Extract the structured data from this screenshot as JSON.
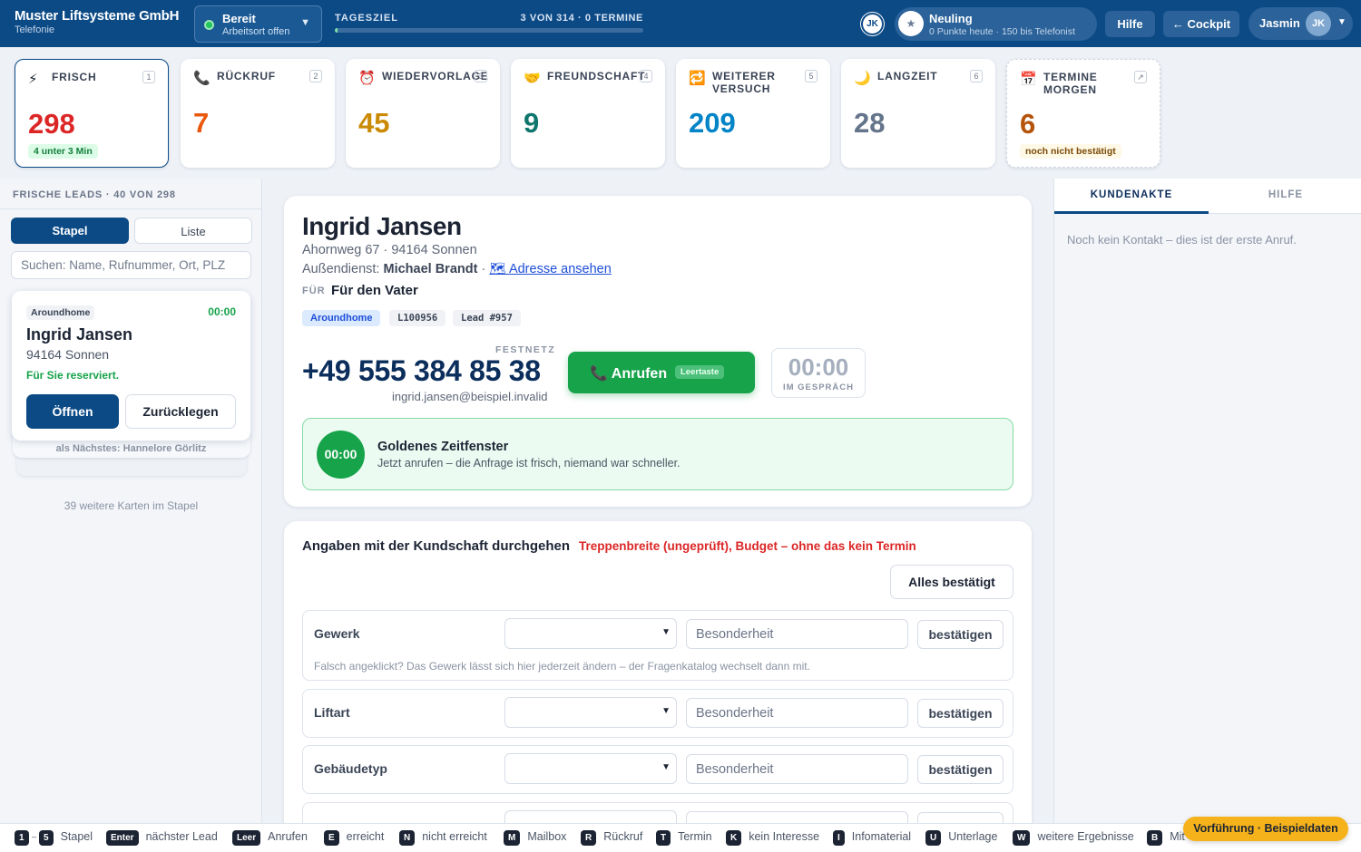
{
  "header": {
    "brand_name": "Muster Liftsysteme GmbH",
    "brand_sub": "Telefonie",
    "status_label": "Bereit",
    "status_sub": "Arbeitsort offen",
    "goal_label": "TAGESZIEL",
    "goal_count": "3 VON 314 · 0 TERMINE",
    "goal_progress": 0.01,
    "initials_badge": "JK",
    "rank_title": "Neuling",
    "rank_sub": "0 Punkte heute · 150 bis Telefonist",
    "help_label": "Hilfe",
    "cockpit_label": "← Cockpit",
    "user_name": "Jasmin",
    "user_initials": "JK"
  },
  "tiles": [
    {
      "icon": "⚡",
      "title": "FRISCH",
      "key": "1",
      "value": "298",
      "note": "4 unter 3 Min",
      "color": "#dc2626"
    },
    {
      "icon": "📞",
      "title": "RÜCKRUF",
      "key": "2",
      "value": "7",
      "note": "",
      "color": "#ea580c"
    },
    {
      "icon": "⏰",
      "title": "WIEDERVORLAGE",
      "key": "3",
      "value": "45",
      "note": "",
      "color": "#ca8a04"
    },
    {
      "icon": "🤝",
      "title": "FREUNDSCHAFT",
      "key": "4",
      "value": "9",
      "note": "",
      "color": "#0f766e"
    },
    {
      "icon": "🔁",
      "title": "WEITERER VERSUCH",
      "key": "5",
      "value": "209",
      "note": "",
      "color": "#0284c7"
    },
    {
      "icon": "🌙",
      "title": "LANGZEIT",
      "key": "6",
      "value": "28",
      "note": "",
      "color": "#64748b"
    },
    {
      "icon": "📅",
      "title": "TERMINE MORGEN",
      "key": "↗",
      "value": "6",
      "note": "noch nicht bestätigt",
      "color": "#b45309"
    }
  ],
  "left": {
    "heading": "FRISCHE LEADS · 40 VON 298",
    "seg_stack": "Stapel",
    "seg_list": "Liste",
    "search_placeholder": "Suchen: Name, Rufnummer, Ort, PLZ",
    "card": {
      "source": "Aroundhome",
      "time": "00:00",
      "name": "Ingrid Jansen",
      "place": "94164 Sonnen",
      "reserved": "Für Sie reserviert.",
      "open": "Öffnen",
      "back": "Zurücklegen"
    },
    "next_label": "als Nächstes: Hannelore Görlitz",
    "more_cards": "39 weitere Karten im Stapel"
  },
  "customer": {
    "name": "Ingrid Jansen",
    "address": "Ahornweg 67 · 94164 Sonnen",
    "ad_prefix": "Außendienst:",
    "ad_name": "Michael Brandt",
    "ad_sep": " · ",
    "ad_link": "🗺 Adresse ansehen",
    "for_label": "FÜR",
    "for_value": "Für den Vater",
    "chips": [
      "Aroundhome",
      "L100956",
      "Lead #957"
    ],
    "phone_label": "FESTNETZ",
    "phone": "+49 555 384 85 38",
    "email": "ingrid.jansen@beispiel.invalid",
    "call_label": "📞 Anrufen",
    "call_key": "Leertaste",
    "timer": "00:00",
    "timer_label": "IM GESPRÄCH",
    "golden_time": "00:00",
    "golden_title": "Goldenes Zeitfenster",
    "golden_text": "Jetzt anrufen – die Anfrage ist frisch, niemand war schneller."
  },
  "questions": {
    "title": "Angaben mit der Kundschaft durchgehen",
    "warning": "Treppenbreite (ungeprüft), Budget – ohne das kein Termin",
    "confirm_all": "Alles bestätigt",
    "input_placeholder": "Besonderheit",
    "confirm_label": "bestätigen",
    "rows": [
      {
        "label": "Gewerk",
        "hint": "Falsch angeklickt? Das Gewerk lässt sich hier jederzeit ändern – der Fragenkatalog wechselt dann mit."
      },
      {
        "label": "Liftart",
        "hint": ""
      },
      {
        "label": "Gebäudetyp",
        "hint": ""
      }
    ]
  },
  "right": {
    "tab_file": "KUNDENAKTE",
    "tab_help": "HILFE",
    "empty": "Noch kein Kontakt – dies ist der erste Anruf."
  },
  "shortcuts": [
    {
      "key": "1",
      "label": ""
    },
    {
      "key": "5",
      "label": "Stapel"
    },
    {
      "key": "Enter",
      "label": "nächster Lead"
    },
    {
      "key": "Leer",
      "label": "Anrufen"
    },
    {
      "key": "E",
      "label": "erreicht"
    },
    {
      "key": "N",
      "label": "nicht erreicht"
    },
    {
      "key": "M",
      "label": "Mailbox"
    },
    {
      "key": "R",
      "label": "Rückruf"
    },
    {
      "key": "T",
      "label": "Termin"
    },
    {
      "key": "K",
      "label": "kein Interesse"
    },
    {
      "key": "I",
      "label": "Infomaterial"
    },
    {
      "key": "U",
      "label": "Unterlage"
    },
    {
      "key": "W",
      "label": "weitere Ergebnisse"
    },
    {
      "key": "B",
      "label": "Mit"
    }
  ],
  "demo_badge": "Vorführung · Beispieldaten"
}
